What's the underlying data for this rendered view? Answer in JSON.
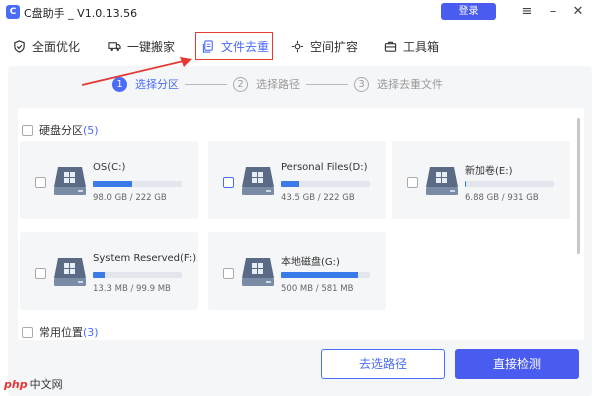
{
  "window": {
    "logo_letter": "C",
    "title": "C盘助手 _ V1.0.13.56",
    "login_label": "登录",
    "controls": [
      "≡",
      "–",
      "✕"
    ]
  },
  "tabs": [
    {
      "label": "全面优化",
      "icon": "shield-icon"
    },
    {
      "label": "一键搬家",
      "icon": "truck-icon"
    },
    {
      "label": "文件去重",
      "icon": "file-copy-icon",
      "active": true
    },
    {
      "label": "空间扩容",
      "icon": "expand-icon"
    },
    {
      "label": "工具箱",
      "icon": "toolbox-icon"
    }
  ],
  "steps": [
    {
      "num": "1",
      "label": "选择分区",
      "active": true
    },
    {
      "num": "2",
      "label": "选择路径",
      "active": false
    },
    {
      "num": "3",
      "label": "选择去重文件",
      "active": false
    }
  ],
  "sections": {
    "disk_label": "硬盘分区",
    "disk_count": "(5)",
    "common_label": "常用位置",
    "common_count": "(3)"
  },
  "drives": [
    {
      "name": "OS(C:)",
      "size": "98.0 GB / 222 GB",
      "used_fraction": 0.44,
      "selected": false
    },
    {
      "name": "Personal Files(D:)",
      "size": "43.5 GB / 222 GB",
      "used_fraction": 0.2,
      "selected": true
    },
    {
      "name": "新加卷(E:)",
      "size": "6.88 GB / 931 GB",
      "used_fraction": 0.01,
      "selected": false
    },
    {
      "name": "System Reserved(F:)",
      "size": "13.3 MB / 99.9 MB",
      "used_fraction": 0.13,
      "selected": false
    },
    {
      "name": "本地磁盘(G:)",
      "size": "500 MB / 581 MB",
      "used_fraction": 0.86,
      "selected": false
    }
  ],
  "buttons": {
    "choose_path": "去选路径",
    "scan": "直接检测"
  },
  "watermark": {
    "logo": "php",
    "text": "中文网"
  },
  "colors": {
    "accent": "#4a6cf7",
    "highlight": "#e53935",
    "bar": "#3b7be8"
  }
}
